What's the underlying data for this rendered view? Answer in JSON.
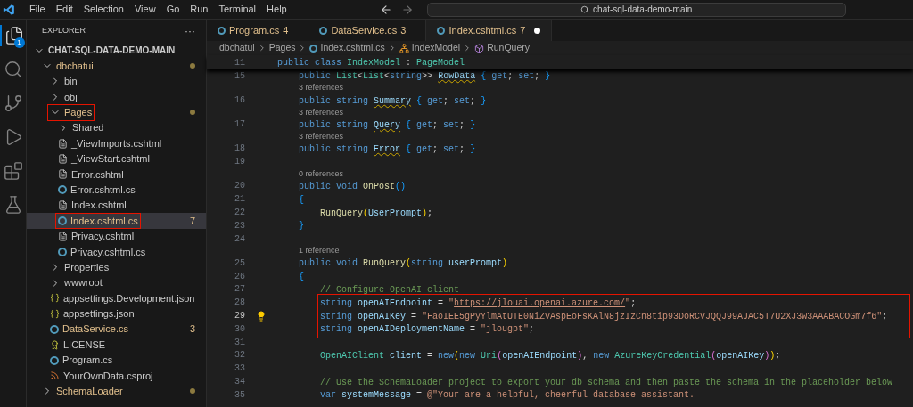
{
  "menu_bar": {
    "items": [
      "File",
      "Edit",
      "Selection",
      "View",
      "Go",
      "Run",
      "Terminal",
      "Help"
    ],
    "search": {
      "value": "chat-sql-data-demo-main"
    }
  },
  "activity_bar": [
    {
      "kind": "explorer",
      "selected": true,
      "badge": "1"
    },
    {
      "kind": "search",
      "selected": false
    },
    {
      "kind": "source-control",
      "selected": false
    },
    {
      "kind": "run",
      "selected": false
    },
    {
      "kind": "extensions",
      "selected": false
    },
    {
      "kind": "testing",
      "selected": false
    }
  ],
  "sidebar": {
    "title": "EXPLORER",
    "more": "···",
    "tree": [
      {
        "name": "CHAT-SQL-DATA-DEMO-MAIN",
        "kind": "root",
        "expanded": true,
        "children": [
          {
            "name": "dbchatui",
            "kind": "folder",
            "expanded": true,
            "modified": true,
            "children": [
              {
                "name": "bin",
                "kind": "folder",
                "expanded": false
              },
              {
                "name": "obj",
                "kind": "folder",
                "expanded": false
              },
              {
                "name": "Pages",
                "kind": "folder",
                "expanded": true,
                "modified": true,
                "outlined": true,
                "children": [
                  {
                    "name": "Shared",
                    "kind": "folder",
                    "expanded": false
                  },
                  {
                    "name": "_ViewImports.cshtml",
                    "kind": "razor"
                  },
                  {
                    "name": "_ViewStart.cshtml",
                    "kind": "razor"
                  },
                  {
                    "name": "Error.cshtml",
                    "kind": "razor"
                  },
                  {
                    "name": "Error.cshtml.cs",
                    "kind": "cs"
                  },
                  {
                    "name": "Index.cshtml",
                    "kind": "razor"
                  },
                  {
                    "name": "Index.cshtml.cs",
                    "kind": "cs",
                    "modified": true,
                    "badge": "7",
                    "selected": true,
                    "outlined": true
                  },
                  {
                    "name": "Privacy.cshtml",
                    "kind": "razor"
                  },
                  {
                    "name": "Privacy.cshtml.cs",
                    "kind": "cs"
                  }
                ]
              },
              {
                "name": "Properties",
                "kind": "folder",
                "expanded": false
              },
              {
                "name": "wwwroot",
                "kind": "folder",
                "expanded": false
              },
              {
                "name": "appsettings.Development.json",
                "kind": "json"
              },
              {
                "name": "appsettings.json",
                "kind": "json"
              },
              {
                "name": "DataService.cs",
                "kind": "cs",
                "modified": true,
                "badge": "3"
              },
              {
                "name": "LICENSE",
                "kind": "license"
              },
              {
                "name": "Program.cs",
                "kind": "cs"
              },
              {
                "name": "YourOwnData.csproj",
                "kind": "csproj"
              }
            ]
          },
          {
            "name": "SchemaLoader",
            "kind": "folder",
            "expanded": false,
            "modified": true
          }
        ]
      }
    ]
  },
  "tabs": [
    {
      "label": "Program.cs",
      "count": "4",
      "selected": false,
      "unsaved": false
    },
    {
      "label": "DataService.cs",
      "count": "3",
      "selected": false,
      "unsaved": false
    },
    {
      "label": "Index.cshtml.cs",
      "count": "7",
      "selected": true,
      "unsaved": true
    }
  ],
  "breadcrumbs": [
    {
      "kind": "folder",
      "label": "dbchatui"
    },
    {
      "kind": "folder",
      "label": "Pages"
    },
    {
      "kind": "cs",
      "label": "Index.cshtml.cs"
    },
    {
      "kind": "class",
      "label": "IndexModel"
    },
    {
      "kind": "method",
      "label": "RunQuery"
    }
  ],
  "sticky_line": {
    "number": "11",
    "tokens": [
      {
        "kind": "kw",
        "text": "    public class "
      },
      {
        "kind": "type",
        "text": "IndexModel"
      },
      {
        "kind": "p",
        "text": " : "
      },
      {
        "kind": "type",
        "text": "PageModel"
      }
    ]
  },
  "lines": [
    {
      "kind": "code",
      "number": "15",
      "tokens": [
        {
          "kind": "kw",
          "text": "        public "
        },
        {
          "kind": "type",
          "text": "List"
        },
        {
          "kind": "p",
          "text": "<"
        },
        {
          "kind": "type",
          "text": "List"
        },
        {
          "kind": "p",
          "text": "<"
        },
        {
          "kind": "kw",
          "text": "string"
        },
        {
          "kind": "p",
          "text": ">> "
        },
        {
          "kind": "warn",
          "text": "RowData"
        },
        {
          "kind": "br",
          "text": " { "
        },
        {
          "kind": "kw",
          "text": "get"
        },
        {
          "kind": "p",
          "text": "; "
        },
        {
          "kind": "kw",
          "text": "set"
        },
        {
          "kind": "p",
          "text": "; "
        },
        {
          "kind": "br",
          "text": "}"
        }
      ]
    },
    {
      "kind": "lens",
      "text": "3 references"
    },
    {
      "kind": "code",
      "number": "16",
      "tokens": [
        {
          "kind": "kw",
          "text": "        public string "
        },
        {
          "kind": "warn",
          "text": "Summary"
        },
        {
          "kind": "br",
          "text": " { "
        },
        {
          "kind": "kw",
          "text": "get"
        },
        {
          "kind": "p",
          "text": "; "
        },
        {
          "kind": "kw",
          "text": "set"
        },
        {
          "kind": "p",
          "text": "; "
        },
        {
          "kind": "br",
          "text": "}"
        }
      ]
    },
    {
      "kind": "lens",
      "text": "3 references"
    },
    {
      "kind": "code",
      "number": "17",
      "tokens": [
        {
          "kind": "kw",
          "text": "        public string "
        },
        {
          "kind": "warn",
          "text": "Query"
        },
        {
          "kind": "br",
          "text": " { "
        },
        {
          "kind": "kw",
          "text": "get"
        },
        {
          "kind": "p",
          "text": "; "
        },
        {
          "kind": "kw",
          "text": "set"
        },
        {
          "kind": "p",
          "text": "; "
        },
        {
          "kind": "br",
          "text": "}"
        }
      ]
    },
    {
      "kind": "lens",
      "text": "3 references"
    },
    {
      "kind": "code",
      "number": "18",
      "tokens": [
        {
          "kind": "kw",
          "text": "        public string "
        },
        {
          "kind": "warn",
          "text": "Error"
        },
        {
          "kind": "br",
          "text": " { "
        },
        {
          "kind": "kw",
          "text": "get"
        },
        {
          "kind": "p",
          "text": "; "
        },
        {
          "kind": "kw",
          "text": "set"
        },
        {
          "kind": "p",
          "text": "; "
        },
        {
          "kind": "br",
          "text": "}"
        }
      ]
    },
    {
      "kind": "code",
      "number": "19"
    },
    {
      "kind": "lens",
      "text": "0 references"
    },
    {
      "kind": "code",
      "number": "20",
      "tokens": [
        {
          "kind": "kw",
          "text": "        public void "
        },
        {
          "kind": "fn",
          "text": "OnPost"
        },
        {
          "kind": "br",
          "text": "()"
        }
      ]
    },
    {
      "kind": "code",
      "number": "21",
      "tokens": [
        {
          "kind": "br",
          "text": "        {"
        }
      ]
    },
    {
      "kind": "code",
      "number": "22",
      "tokens": [
        {
          "kind": "fn",
          "text": "            RunQuery"
        },
        {
          "kind": "paren",
          "text": "("
        },
        {
          "kind": "var",
          "text": "UserPrompt"
        },
        {
          "kind": "paren",
          "text": ")"
        },
        {
          "kind": "p",
          "text": ";"
        }
      ]
    },
    {
      "kind": "code",
      "number": "23",
      "tokens": [
        {
          "kind": "br",
          "text": "        }"
        }
      ]
    },
    {
      "kind": "code",
      "number": "24"
    },
    {
      "kind": "lens",
      "text": "1 reference"
    },
    {
      "kind": "code",
      "number": "25",
      "tokens": [
        {
          "kind": "kw",
          "text": "        public void "
        },
        {
          "kind": "fn",
          "text": "RunQuery"
        },
        {
          "kind": "paren",
          "text": "("
        },
        {
          "kind": "kw",
          "text": "string "
        },
        {
          "kind": "var",
          "text": "userPrompt"
        },
        {
          "kind": "paren",
          "text": ")"
        }
      ]
    },
    {
      "kind": "code",
      "number": "26",
      "tokens": [
        {
          "kind": "br",
          "text": "        {"
        }
      ]
    },
    {
      "kind": "code",
      "number": "27",
      "tokens": [
        {
          "kind": "comment",
          "text": "            // Configure OpenAI client"
        }
      ]
    },
    {
      "kind": "code",
      "number": "28",
      "boxed": true,
      "tokens": [
        {
          "kind": "kw",
          "text": "            string "
        },
        {
          "kind": "var",
          "text": "openAIEndpoint"
        },
        {
          "kind": "p",
          "text": " = "
        },
        {
          "kind": "str",
          "text": "\""
        },
        {
          "kind": "url",
          "text": "https://jlouai.openai.azure.com/"
        },
        {
          "kind": "str",
          "text": "\""
        },
        {
          "kind": "p",
          "text": ";"
        }
      ]
    },
    {
      "kind": "code",
      "number": "29",
      "boxed": true,
      "current": true,
      "tokens": [
        {
          "kind": "kw",
          "text": "            string "
        },
        {
          "kind": "var",
          "text": "openAIKey"
        },
        {
          "kind": "p",
          "text": " = "
        },
        {
          "kind": "str",
          "text": "\"FaoIEE5gPyYlmAtUTE0NiZvAspEoFsKAlN8jzIzCn8tip93DoRCVJQQJ99AJAC5T7U2XJ3w3AAABACOGm7f6\""
        },
        {
          "kind": "p",
          "text": ";"
        }
      ]
    },
    {
      "kind": "code",
      "number": "30",
      "boxed": true,
      "tokens": [
        {
          "kind": "kw",
          "text": "            string "
        },
        {
          "kind": "var",
          "text": "openAIDeploymentName"
        },
        {
          "kind": "p",
          "text": " = "
        },
        {
          "kind": "str",
          "text": "\"jlougpt\""
        },
        {
          "kind": "p",
          "text": ";"
        }
      ]
    },
    {
      "kind": "code",
      "number": "31"
    },
    {
      "kind": "code",
      "number": "32",
      "tokens": [
        {
          "kind": "type",
          "text": "            OpenAIClient "
        },
        {
          "kind": "var",
          "text": "client"
        },
        {
          "kind": "p",
          "text": " = "
        },
        {
          "kind": "kw",
          "text": "new"
        },
        {
          "kind": "paren",
          "text": "("
        },
        {
          "kind": "kw",
          "text": "new "
        },
        {
          "kind": "type",
          "text": "Uri"
        },
        {
          "kind": "paren2",
          "text": "("
        },
        {
          "kind": "var",
          "text": "openAIEndpoint"
        },
        {
          "kind": "paren2",
          "text": ")"
        },
        {
          "kind": "p",
          "text": ", "
        },
        {
          "kind": "kw",
          "text": "new "
        },
        {
          "kind": "type",
          "text": "AzureKeyCredential"
        },
        {
          "kind": "paren2",
          "text": "("
        },
        {
          "kind": "var",
          "text": "openAIKey"
        },
        {
          "kind": "paren2",
          "text": ")"
        },
        {
          "kind": "paren",
          "text": ")"
        },
        {
          "kind": "p",
          "text": ";"
        }
      ]
    },
    {
      "kind": "code",
      "number": "33"
    },
    {
      "kind": "code",
      "number": "34",
      "tokens": [
        {
          "kind": "comment",
          "text": "            // Use the SchemaLoader project to export your db schema and then paste the schema in the placeholder below"
        }
      ]
    },
    {
      "kind": "code",
      "number": "35",
      "tokens": [
        {
          "kind": "kw",
          "text": "            var "
        },
        {
          "kind": "var",
          "text": "systemMessage"
        },
        {
          "kind": "p",
          "text": " = "
        },
        {
          "kind": "str",
          "text": "@\"Your are a helpful, cheerful database assistant."
        }
      ]
    }
  ]
}
